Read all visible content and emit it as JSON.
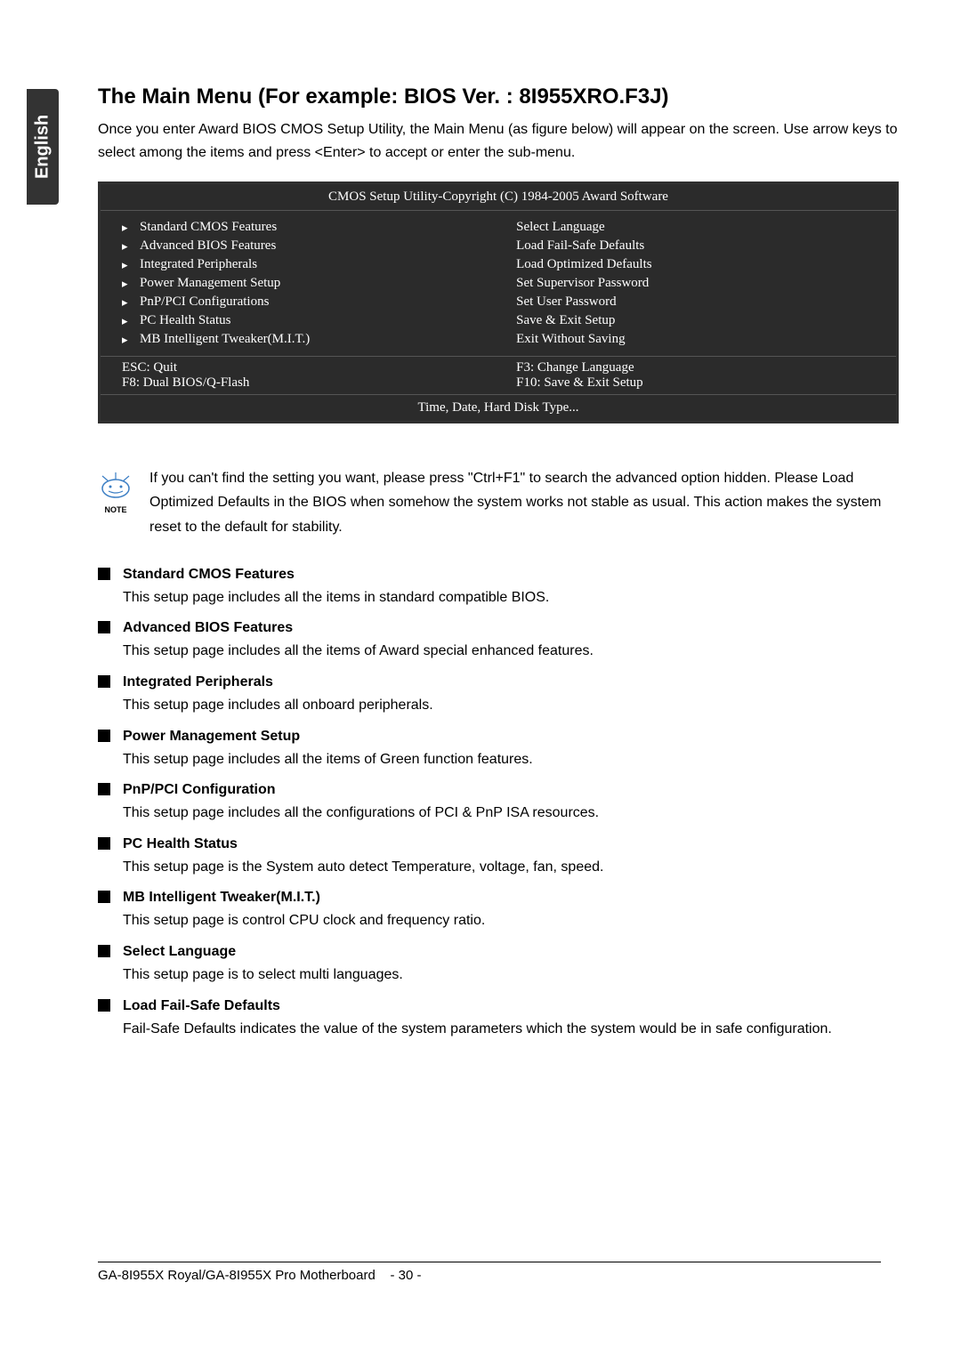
{
  "language_tab": "English",
  "title": "The Main Menu (For example: BIOS Ver. : 8I955XRO.F3J)",
  "intro": "Once you enter Award BIOS CMOS Setup Utility, the Main Menu (as figure below) will appear on the screen. Use arrow keys to select among the items and press <Enter> to accept or enter the sub-menu.",
  "bios": {
    "header": "CMOS Setup Utility-Copyright (C) 1984-2005 Award Software",
    "left_items": [
      "Standard CMOS Features",
      "Advanced BIOS Features",
      "Integrated Peripherals",
      "Power Management Setup",
      "PnP/PCI Configurations",
      "PC Health Status",
      "MB Intelligent Tweaker(M.I.T.)"
    ],
    "right_items": [
      "Select Language",
      "Load Fail-Safe Defaults",
      "Load Optimized Defaults",
      "Set Supervisor Password",
      "Set User Password",
      "Save & Exit Setup",
      "Exit Without Saving"
    ],
    "keys_left": [
      "ESC: Quit",
      "F8: Dual BIOS/Q-Flash"
    ],
    "keys_right": [
      "F3: Change Language",
      "F10: Save & Exit Setup"
    ],
    "footer": "Time, Date, Hard Disk Type..."
  },
  "note_label": "NOTE",
  "note_text": "If you can't find the setting you want, please press \"Ctrl+F1\" to search the advanced option hidden. Please Load Optimized Defaults in the BIOS when somehow the system works not stable as usual. This action makes the system reset to the default for stability.",
  "sections": [
    {
      "title": "Standard CMOS Features",
      "desc": "This setup page includes all the items in standard compatible BIOS."
    },
    {
      "title": "Advanced BIOS Features",
      "desc": "This setup page includes all the items of Award special enhanced features."
    },
    {
      "title": "Integrated Peripherals",
      "desc": "This setup page includes all onboard peripherals."
    },
    {
      "title": "Power Management Setup",
      "desc": "This setup page includes all the items of Green function features."
    },
    {
      "title": "PnP/PCI Configuration",
      "desc": "This setup page includes all the configurations of PCI & PnP ISA resources."
    },
    {
      "title": "PC Health Status",
      "desc": "This setup page is the System auto detect Temperature, voltage, fan, speed."
    },
    {
      "title": "MB Intelligent Tweaker(M.I.T.)",
      "desc": "This setup page is control CPU clock and frequency ratio."
    },
    {
      "title": "Select Language",
      "desc": "This setup page is to select multi languages."
    },
    {
      "title": "Load Fail-Safe Defaults",
      "desc": "Fail-Safe Defaults indicates the value of the system parameters which the system would be in safe configuration."
    }
  ],
  "footer_text": "GA-8I955X Royal/GA-8I955X Pro Motherboard",
  "page_number": "- 30 -"
}
